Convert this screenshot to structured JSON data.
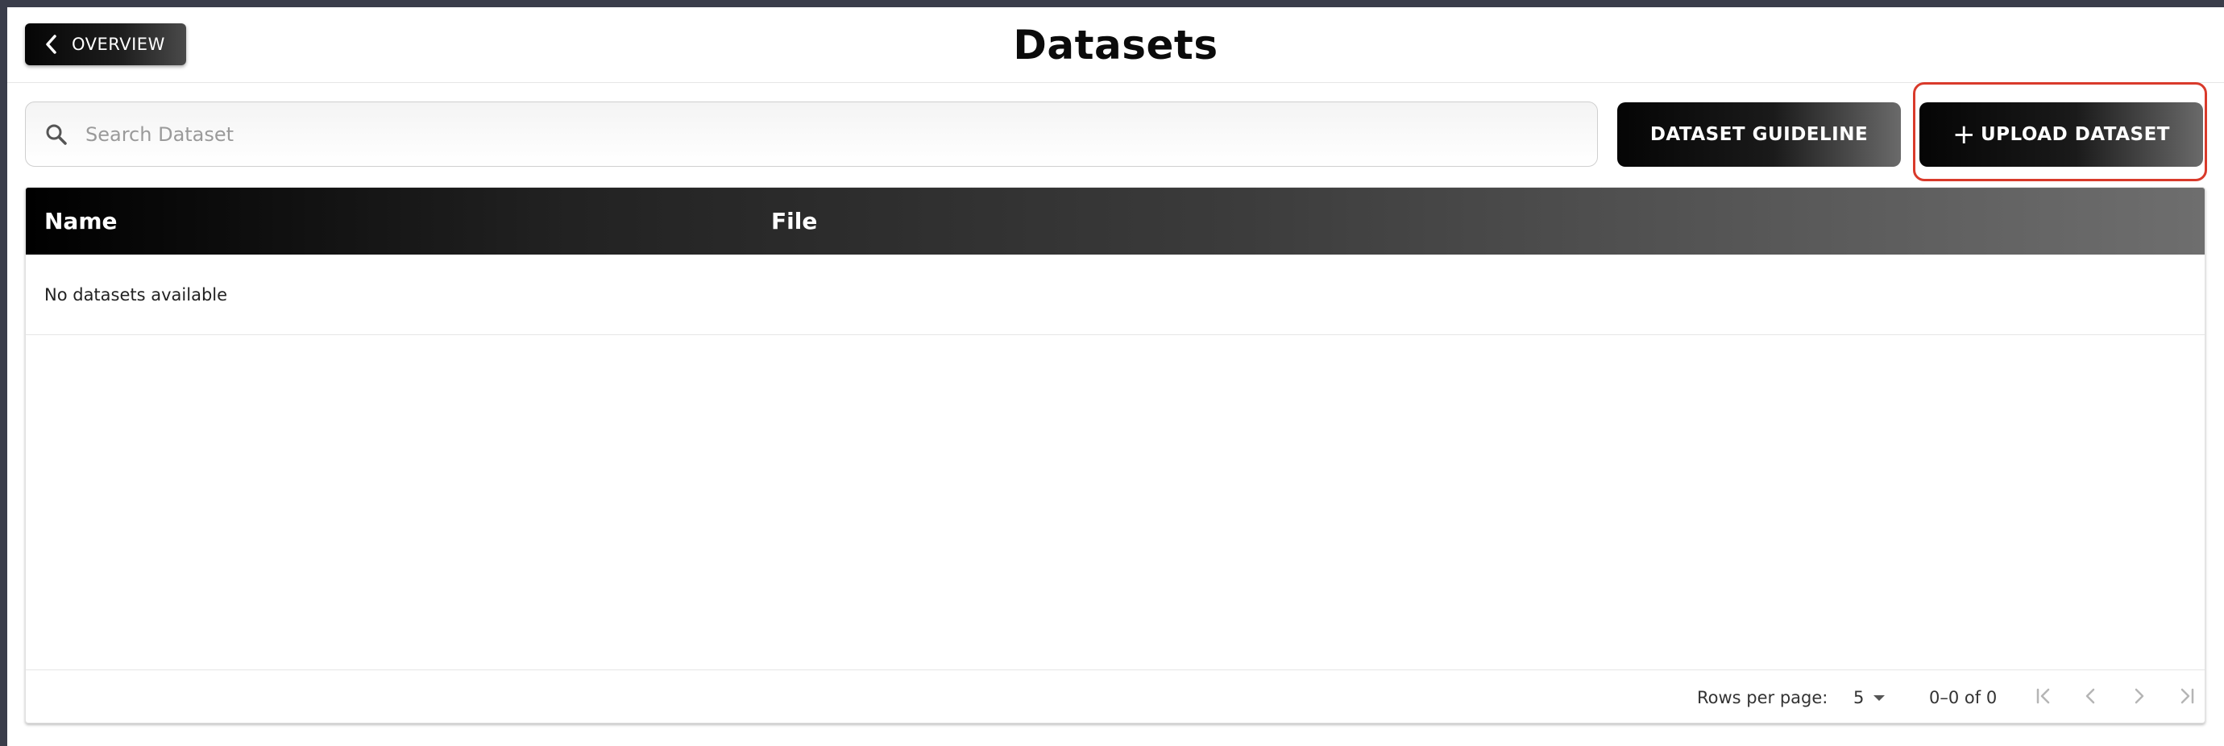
{
  "header": {
    "back_label": "OVERVIEW",
    "title": "Datasets"
  },
  "toolbar": {
    "search_placeholder": "Search Dataset",
    "search_value": "",
    "guideline_label": "DATASET GUIDELINE",
    "upload_plus": "+",
    "upload_label": "UPLOAD DATASET"
  },
  "table": {
    "columns": [
      "Name",
      "File"
    ],
    "empty_message": "No datasets available"
  },
  "pagination": {
    "rows_per_page_label": "Rows per page:",
    "rows_per_page_value": "5",
    "range_text": "0–0 of 0"
  },
  "colors": {
    "highlight_border": "#d93a2b",
    "button_dark": "#050505"
  },
  "icons": {
    "back": "chevron-left-icon",
    "search": "search-icon",
    "first_page": "first-page-icon",
    "prev_page": "chevron-left-icon",
    "next_page": "chevron-right-icon",
    "last_page": "last-page-icon"
  }
}
